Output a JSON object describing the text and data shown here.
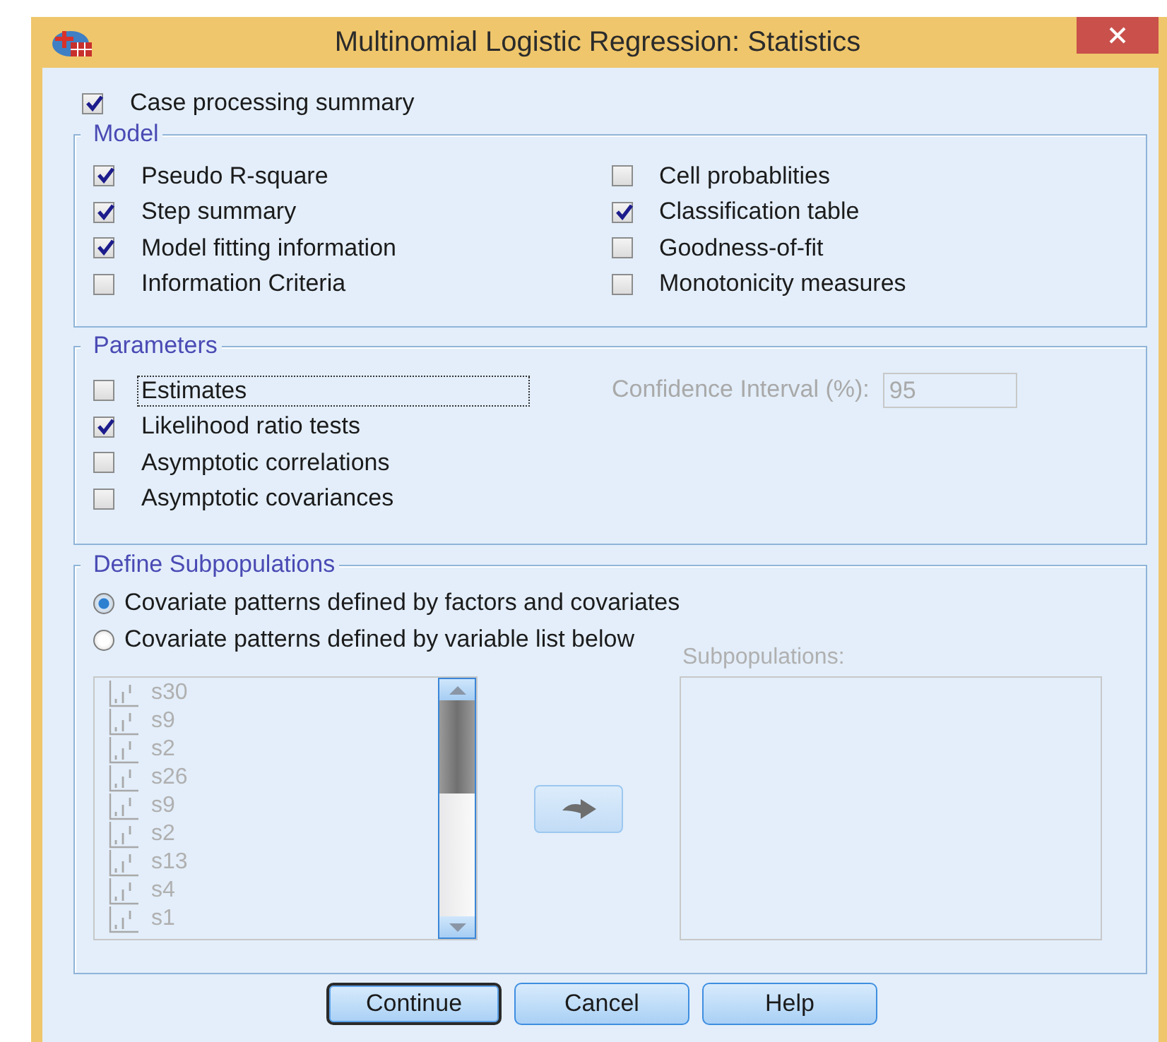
{
  "window": {
    "title": "Multinomial Logistic Regression: Statistics"
  },
  "case_processing_summary": {
    "label": "Case processing summary",
    "checked": true
  },
  "model": {
    "title": "Model",
    "left": [
      {
        "label": "Pseudo R-square",
        "checked": true
      },
      {
        "label": "Step summary",
        "checked": true
      },
      {
        "label": "Model fitting information",
        "checked": true
      },
      {
        "label": "Information Criteria",
        "checked": false
      }
    ],
    "right": [
      {
        "label": "Cell probablities",
        "checked": false
      },
      {
        "label": "Classification table",
        "checked": true
      },
      {
        "label": "Goodness-of-fit",
        "checked": false
      },
      {
        "label": "Monotonicity measures",
        "checked": false
      }
    ]
  },
  "parameters": {
    "title": "Parameters",
    "options": [
      {
        "label": "Estimates",
        "checked": false,
        "focused": true
      },
      {
        "label": "Likelihood ratio tests",
        "checked": true,
        "focused": false
      },
      {
        "label": "Asymptotic correlations",
        "checked": false,
        "focused": false
      },
      {
        "label": "Asymptotic covariances",
        "checked": false,
        "focused": false
      }
    ],
    "confidence_interval": {
      "label": "Confidence Interval (%):",
      "value": "95",
      "disabled": true
    }
  },
  "define_subpopulations": {
    "title": "Define Subpopulations",
    "radios": [
      {
        "label": "Covariate patterns defined by factors and covariates",
        "selected": true
      },
      {
        "label": "Covariate patterns defined by variable list below",
        "selected": false
      }
    ],
    "variables": {
      "disabled": true,
      "items": [
        "s30",
        "s9",
        "s2",
        "s26",
        "s9",
        "s2",
        "s13",
        "s4",
        "s1"
      ]
    },
    "subpopulations": {
      "label": "Subpopulations:",
      "disabled": true
    }
  },
  "buttons": [
    {
      "label": "Continue",
      "focused": true
    },
    {
      "label": "Cancel",
      "focused": false
    },
    {
      "label": "Help",
      "focused": false
    }
  ]
}
